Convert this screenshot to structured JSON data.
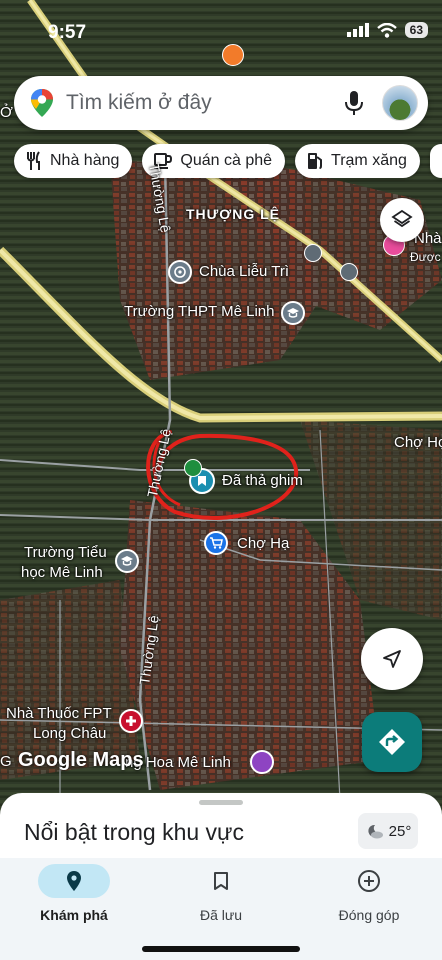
{
  "status": {
    "time": "9:57",
    "battery": "63"
  },
  "search": {
    "placeholder": "Tìm kiếm ở đây"
  },
  "chips": [
    {
      "label": "Nhà hàng",
      "icon": "restaurant-icon"
    },
    {
      "label": "Quán cà phê",
      "icon": "coffee-icon"
    },
    {
      "label": "Trạm xăng",
      "icon": "gas-station-icon"
    }
  ],
  "map": {
    "labels": {
      "area": "THƯỢNG LỆ",
      "road1": "Thường Lệ",
      "road2": "Thường Lệ",
      "road3": "Thường Lệ",
      "temple": "Chùa Liễu Trì",
      "school_high": "Trường THPT Mê Linh",
      "saved_place": "Đã thả ghim",
      "market": "Chợ Hạ",
      "market_edge": "Chợ Hợ",
      "primary_line1": "Trường Tiểu",
      "primary_line2": "học Mê Linh",
      "pharmacy_line1": "Nhà Thuốc FPT",
      "pharmacy_line2": "Long Châu",
      "flower": "ng Hoa Mê Linh",
      "right_edge1": "Nhà",
      "right_edge2": "Được",
      "left_edge": "Ở",
      "left_edge2": "G"
    },
    "watermark": "Google Maps"
  },
  "sheet": {
    "title": "Nổi bật trong khu vực",
    "weather": "25°"
  },
  "nav": {
    "explore": "Khám phá",
    "saved": "Đã lưu",
    "contribute": "Đóng góp"
  },
  "colors": {
    "accent": "#0c7c7a",
    "annotation": "#e0221b",
    "nav_active": "#c2e7f5"
  }
}
